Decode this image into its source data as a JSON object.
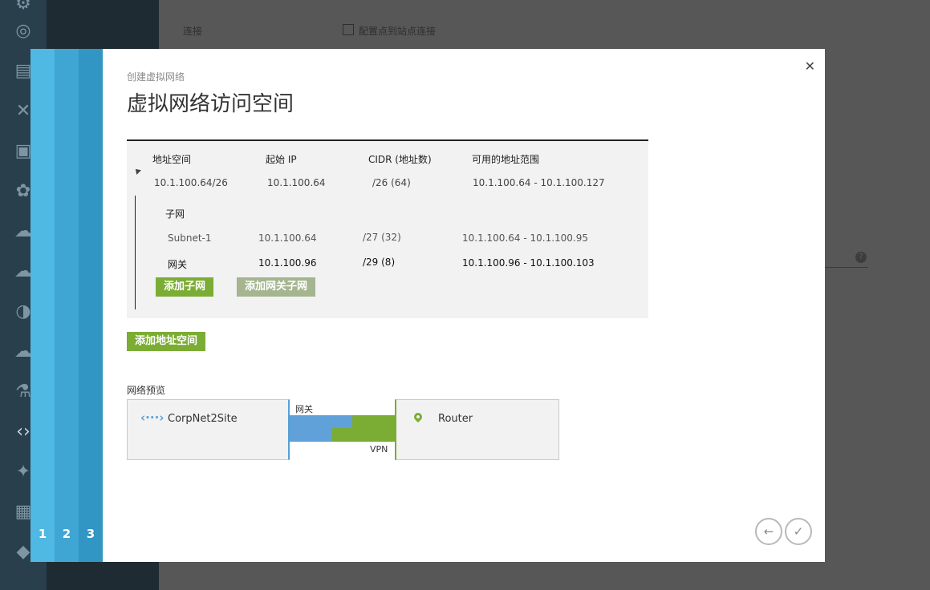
{
  "background": {
    "connection_label": "连接",
    "checkbox_label": "配置点到站点连接",
    "help_icon": "question-icon",
    "sidebar_icons": [
      "websites-icon",
      "mobile-services-icon",
      "visual-studio-icon",
      "sql-databases-icon",
      "hdinsight-icon",
      "cloud-services-icon",
      "storage-icon",
      "media-services-icon",
      "active-directory-icon",
      "machine-learning-icon",
      "networks-icon",
      "traffic-manager-icon",
      "management-services-icon",
      "service-bus-icon",
      "settings-icon"
    ]
  },
  "wizard": {
    "steps": [
      "1",
      "2",
      "3"
    ],
    "step_colors": [
      "#4fb8e3",
      "#3fa6d4",
      "#3196c4"
    ]
  },
  "dialog": {
    "subtitle": "创建虚拟网络",
    "title": "虚拟网络访问空间",
    "close_icon": "close-icon",
    "address_space": {
      "headers": [
        "地址空间",
        "起始 IP",
        "CIDR (地址数)",
        "可用的地址范围"
      ],
      "row": {
        "space": "10.1.100.64/26",
        "start_ip": "10.1.100.64",
        "cidr": "/26 (64)",
        "range": "10.1.100.64 - 10.1.100.127"
      },
      "subnet_heading": "子网",
      "subnets": [
        {
          "name": "Subnet-1",
          "start_ip": "10.1.100.64",
          "cidr": "/27 (32)",
          "range": "10.1.100.64 - 10.1.100.95"
        },
        {
          "name": "网关",
          "start_ip": "10.1.100.96",
          "cidr": "/29 (8)",
          "range": "10.1.100.96 - 10.1.100.103"
        }
      ],
      "add_subnet_label": "添加子网",
      "add_gateway_subnet_label": "添加网关子网"
    },
    "add_address_space_label": "添加地址空间",
    "preview": {
      "label": "网络预览",
      "network_name": "CorpNet2Site",
      "gateway_label": "网关",
      "vpn_label": "VPN",
      "router_label": "Router"
    },
    "nav": {
      "back_icon": "arrow-left-icon",
      "finish_icon": "checkmark-icon"
    }
  }
}
